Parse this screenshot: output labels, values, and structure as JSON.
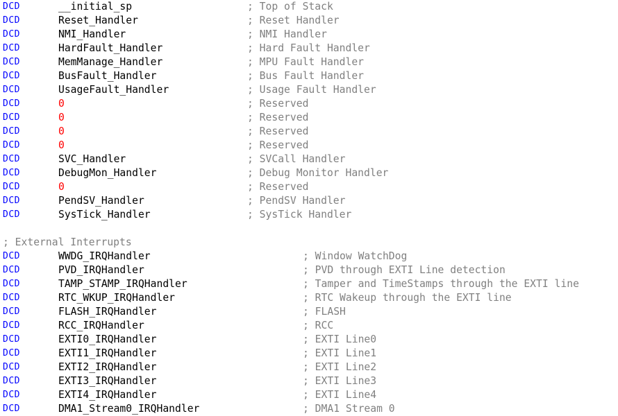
{
  "editor": {
    "title": "startup_stm32f4xx.s",
    "language": "ARM Assembly",
    "background_color": "#ffffff",
    "colors": {
      "keyword": "#0000ff",
      "identifier": "#000000",
      "number": "#ff0000",
      "comment": "#808080"
    },
    "keyword": "DCD",
    "comment_marker": ";"
  },
  "lines": [
    {
      "type": "code",
      "keyword": "DCD",
      "operand": "__initial_sp",
      "operand_kind": "identifier",
      "comment": "; Top of Stack",
      "comment_col": "a"
    },
    {
      "type": "code",
      "keyword": "DCD",
      "operand": "Reset_Handler",
      "operand_kind": "identifier",
      "comment": "; Reset Handler",
      "comment_col": "a"
    },
    {
      "type": "code",
      "keyword": "DCD",
      "operand": "NMI_Handler",
      "operand_kind": "identifier",
      "comment": "; NMI Handler",
      "comment_col": "a"
    },
    {
      "type": "code",
      "keyword": "DCD",
      "operand": "HardFault_Handler",
      "operand_kind": "identifier",
      "comment": "; Hard Fault Handler",
      "comment_col": "a"
    },
    {
      "type": "code",
      "keyword": "DCD",
      "operand": "MemManage_Handler",
      "operand_kind": "identifier",
      "comment": "; MPU Fault Handler",
      "comment_col": "a"
    },
    {
      "type": "code",
      "keyword": "DCD",
      "operand": "BusFault_Handler",
      "operand_kind": "identifier",
      "comment": "; Bus Fault Handler",
      "comment_col": "a"
    },
    {
      "type": "code",
      "keyword": "DCD",
      "operand": "UsageFault_Handler",
      "operand_kind": "identifier",
      "comment": "; Usage Fault Handler",
      "comment_col": "a"
    },
    {
      "type": "code",
      "keyword": "DCD",
      "operand": "0",
      "operand_kind": "number",
      "comment": "; Reserved",
      "comment_col": "a"
    },
    {
      "type": "code",
      "keyword": "DCD",
      "operand": "0",
      "operand_kind": "number",
      "comment": "; Reserved",
      "comment_col": "a"
    },
    {
      "type": "code",
      "keyword": "DCD",
      "operand": "0",
      "operand_kind": "number",
      "comment": "; Reserved",
      "comment_col": "a"
    },
    {
      "type": "code",
      "keyword": "DCD",
      "operand": "0",
      "operand_kind": "number",
      "comment": "; Reserved",
      "comment_col": "a"
    },
    {
      "type": "code",
      "keyword": "DCD",
      "operand": "SVC_Handler",
      "operand_kind": "identifier",
      "comment": "; SVCall Handler",
      "comment_col": "a"
    },
    {
      "type": "code",
      "keyword": "DCD",
      "operand": "DebugMon_Handler",
      "operand_kind": "identifier",
      "comment": "; Debug Monitor Handler",
      "comment_col": "a"
    },
    {
      "type": "code",
      "keyword": "DCD",
      "operand": "0",
      "operand_kind": "number",
      "comment": "; Reserved",
      "comment_col": "a"
    },
    {
      "type": "code",
      "keyword": "DCD",
      "operand": "PendSV_Handler",
      "operand_kind": "identifier",
      "comment": "; PendSV Handler",
      "comment_col": "a"
    },
    {
      "type": "code",
      "keyword": "DCD",
      "operand": "SysTick_Handler",
      "operand_kind": "identifier",
      "comment": "; SysTick Handler",
      "comment_col": "a"
    },
    {
      "type": "blank"
    },
    {
      "type": "comment_only",
      "comment": "; External Interrupts"
    },
    {
      "type": "code",
      "keyword": "DCD",
      "operand": "WWDG_IRQHandler",
      "operand_kind": "identifier",
      "comment": "; Window WatchDog",
      "comment_col": "b"
    },
    {
      "type": "code",
      "keyword": "DCD",
      "operand": "PVD_IRQHandler",
      "operand_kind": "identifier",
      "comment": "; PVD through EXTI Line detection",
      "comment_col": "b"
    },
    {
      "type": "code",
      "keyword": "DCD",
      "operand": "TAMP_STAMP_IRQHandler",
      "operand_kind": "identifier",
      "comment": "; Tamper and TimeStamps through the EXTI line",
      "comment_col": "b"
    },
    {
      "type": "code",
      "keyword": "DCD",
      "operand": "RTC_WKUP_IRQHandler",
      "operand_kind": "identifier",
      "comment": "; RTC Wakeup through the EXTI line",
      "comment_col": "b"
    },
    {
      "type": "code",
      "keyword": "DCD",
      "operand": "FLASH_IRQHandler",
      "operand_kind": "identifier",
      "comment": "; FLASH",
      "comment_col": "b"
    },
    {
      "type": "code",
      "keyword": "DCD",
      "operand": "RCC_IRQHandler",
      "operand_kind": "identifier",
      "comment": "; RCC",
      "comment_col": "b"
    },
    {
      "type": "code",
      "keyword": "DCD",
      "operand": "EXTI0_IRQHandler",
      "operand_kind": "identifier",
      "comment": "; EXTI Line0",
      "comment_col": "b"
    },
    {
      "type": "code",
      "keyword": "DCD",
      "operand": "EXTI1_IRQHandler",
      "operand_kind": "identifier",
      "comment": "; EXTI Line1",
      "comment_col": "b"
    },
    {
      "type": "code",
      "keyword": "DCD",
      "operand": "EXTI2_IRQHandler",
      "operand_kind": "identifier",
      "comment": "; EXTI Line2",
      "comment_col": "b"
    },
    {
      "type": "code",
      "keyword": "DCD",
      "operand": "EXTI3_IRQHandler",
      "operand_kind": "identifier",
      "comment": "; EXTI Line3",
      "comment_col": "b"
    },
    {
      "type": "code",
      "keyword": "DCD",
      "operand": "EXTI4_IRQHandler",
      "operand_kind": "identifier",
      "comment": "; EXTI Line4",
      "comment_col": "b"
    },
    {
      "type": "code",
      "keyword": "DCD",
      "operand": "DMA1_Stream0_IRQHandler",
      "operand_kind": "identifier",
      "comment": "; DMA1 Stream 0",
      "comment_col": "b"
    }
  ]
}
